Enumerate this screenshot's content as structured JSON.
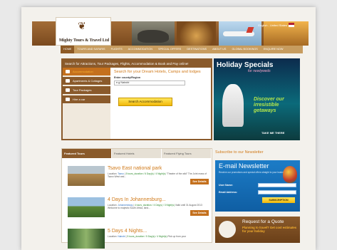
{
  "header": {
    "logo_text": "Mighty Tours & Travel Ltd",
    "language": "English - United States"
  },
  "nav": [
    "HOME",
    "TOURS AND SAFARIS",
    "FLIGHTS",
    "ACCOMMODATION",
    "SPECIAL OFFERS",
    "DESTINATIONS",
    "ABOUT US",
    "GLOBAL BOOKINGS",
    "ENQUIRE NOW"
  ],
  "search": {
    "headline": "Search for Attractions, Tour Packages, Flights, Accommodation & Book and Pay online!",
    "tabs": [
      "Accommodation",
      "Apartments & Cottages",
      "Tour Packages",
      "Hire a car"
    ],
    "title": "Search for your Dream Hotels, Camps and lodges",
    "label": "Enter county/Region",
    "value": "e.g Nairobi",
    "button": "Search Accommodation"
  },
  "holiday": {
    "title": "Holiday Specials",
    "subtitle": "for newlyweds",
    "discover": "Discover our irresistible getaways",
    "cta": "TAKE ME THERE"
  },
  "tours": {
    "tabs": [
      "Featured Tours",
      "Featured Hotels",
      "Featured Flying Tours"
    ],
    "items": [
      {
        "title": "Tsavo East national park",
        "location_label": "Location:",
        "location": "Tsavo",
        "duration": "5 tours_duration / 6 Day(s) / 4 Night(s)",
        "desc": "\"Theatre of the wild\" The Joint mass of Tsavo West and...",
        "button": "See Details"
      },
      {
        "title": "4 Days In Johannesburg...",
        "location_label": "Location:",
        "location": "Johannesburg",
        "duration": "4 tours_duration / 4 Day(s) / 3 Night(s)",
        "desc": "Valid until 31 August 2013 Welcome to majestic South Africa, land...",
        "button": "See Details"
      },
      {
        "title": "5 Days 4 Nights...",
        "location_label": "Location:",
        "location": "Nairobi",
        "duration": "5 tours_duration / 5 Day(s) / 4 Night(s)",
        "desc": "Pick up from your",
        "button": "See Details"
      }
    ]
  },
  "newsletter": {
    "heading": "Subscribe to our Newsletter",
    "title": "E-mail Newsletter",
    "text": "Receive our promotions and special offers straight to your business needs",
    "name_label": "User Name:",
    "email_label": "Email Address:",
    "button": "SUBSCRIPTION"
  },
  "quote": {
    "title": "Request for a Quote",
    "text": "Planning to travel? Get cost estimates for your holiday"
  }
}
